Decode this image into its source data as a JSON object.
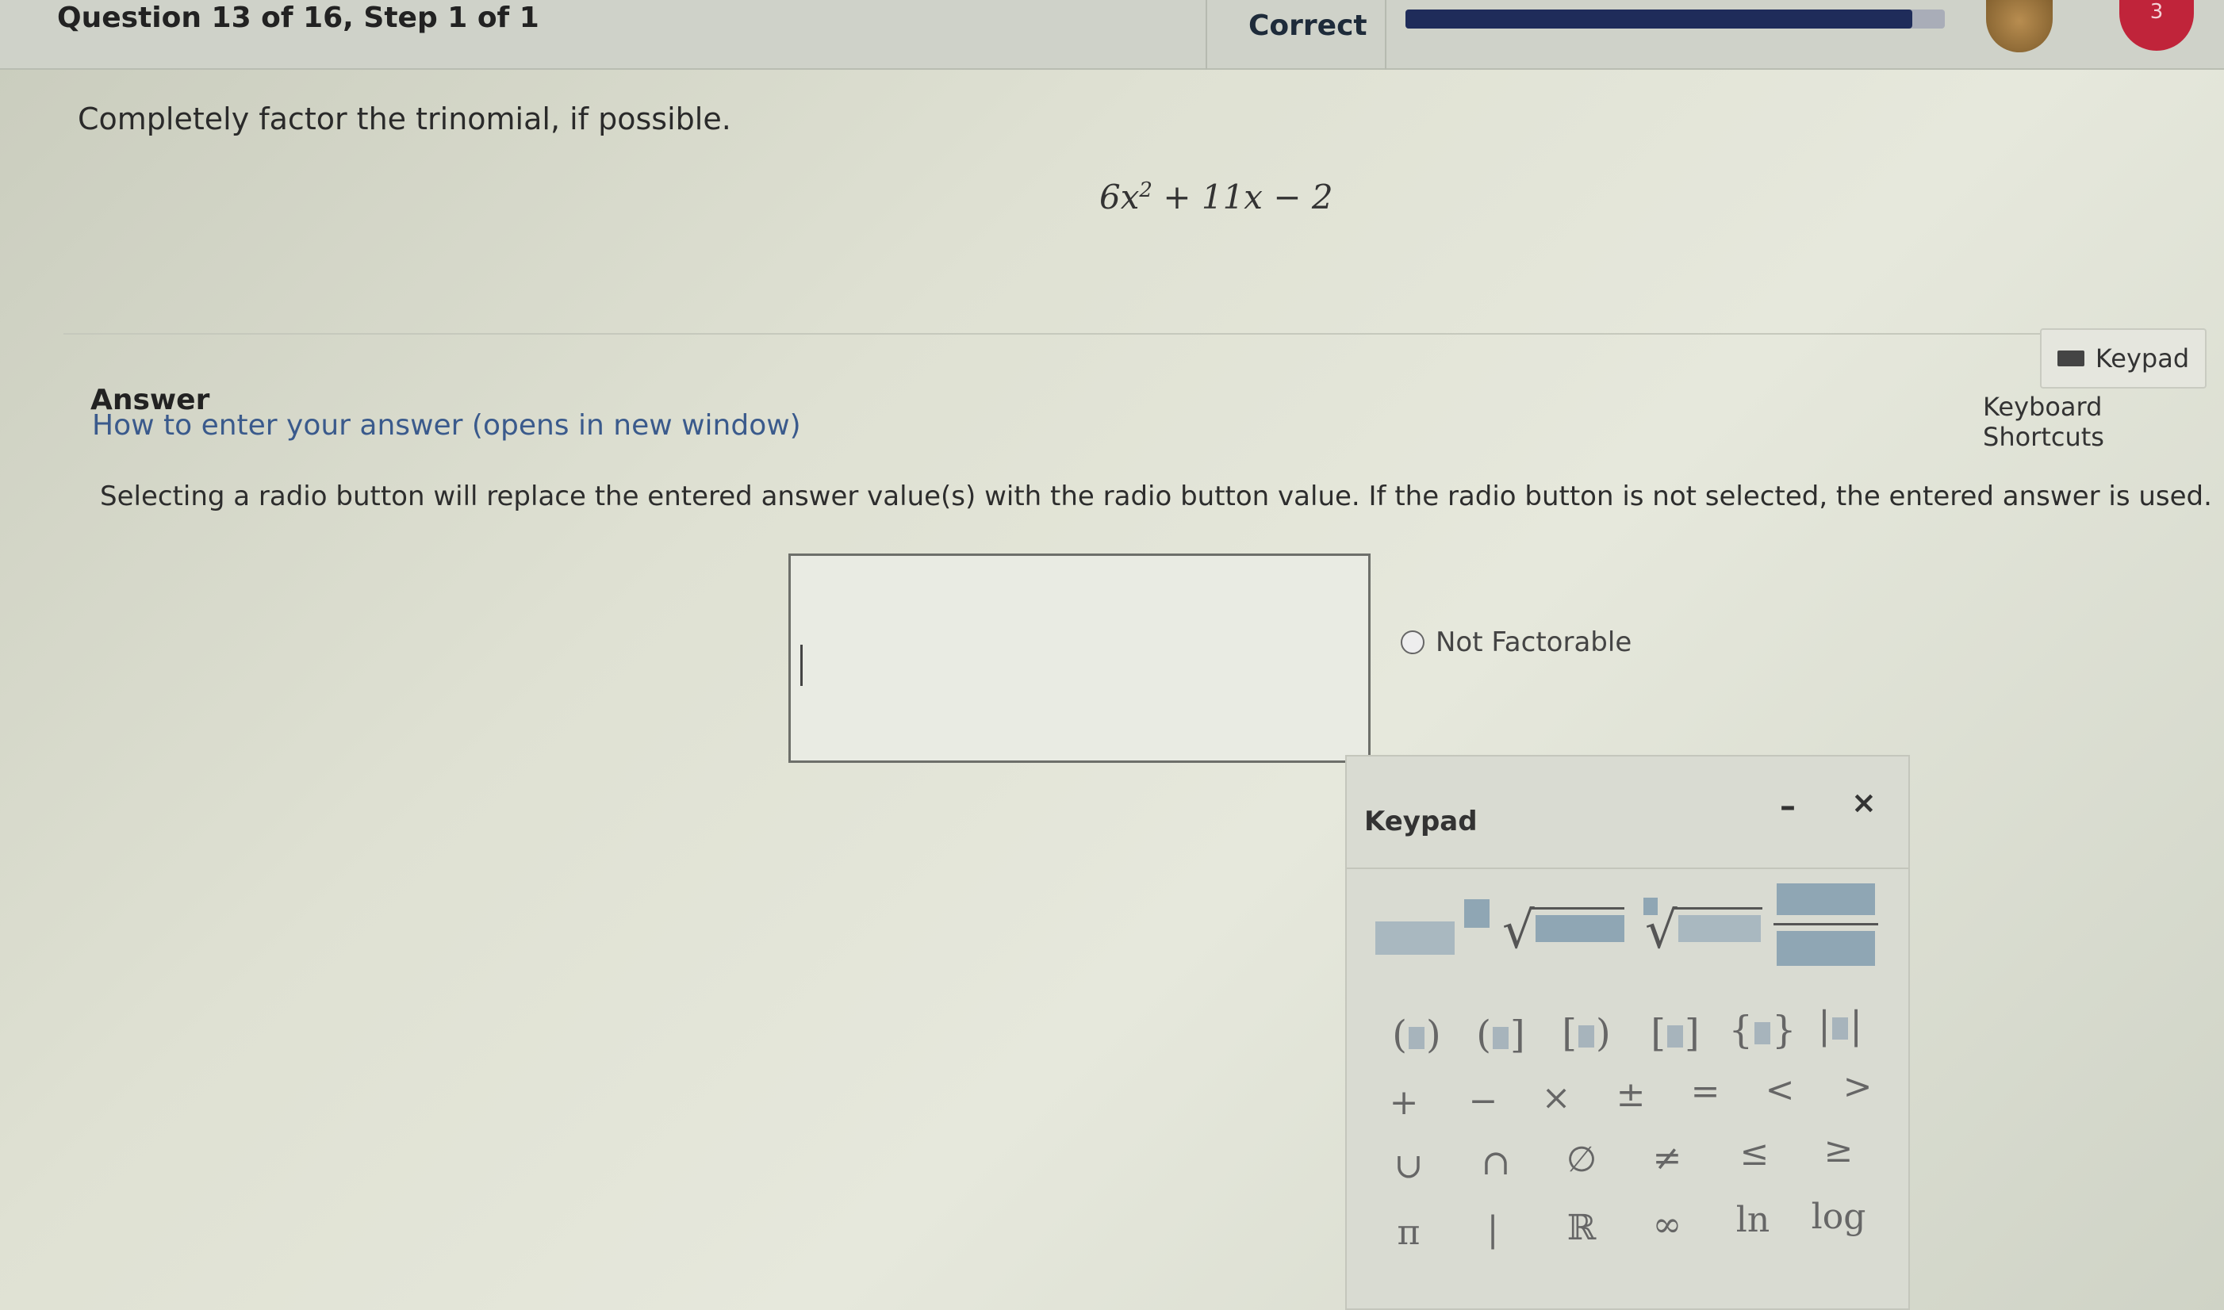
{
  "header": {
    "question_progress": "Question 13 of 16, Step 1 of 1",
    "status": "Correct",
    "progress_fraction": 0.94,
    "hearts": "3"
  },
  "question": {
    "prompt": "Completely factor the trinomial, if possible.",
    "expression": {
      "lead": "6x",
      "exponent": "2",
      "rest": " + 11x − 2"
    }
  },
  "answer": {
    "label": "Answer",
    "how_to_link": "How to enter your answer (opens in new window)",
    "instructions": "Selecting a radio button will replace the entered answer value(s) with the radio button value. If the radio button is not selected, the entered answer is used.",
    "input_value": "",
    "radio_option": "Not Factorable"
  },
  "tools": {
    "keypad_button": "Keypad",
    "shortcuts_link": "Keyboard Shortcuts"
  },
  "keypad": {
    "title": "Keypad",
    "minimize": "–",
    "close": "×",
    "row_brackets": [
      "(",
      ")",
      "(",
      "]",
      "[",
      ")",
      "[",
      "]",
      "{",
      "}",
      "|",
      "|"
    ],
    "row_ops": [
      "+",
      "−",
      "×",
      "±",
      "=",
      "<",
      ">"
    ],
    "row_sets": [
      "∪",
      "∩",
      "∅",
      "≠",
      "≤",
      "≥"
    ],
    "row_misc": [
      "π",
      "|",
      "ℝ",
      "∞",
      "ln",
      "log"
    ]
  },
  "colors": {
    "status_bar_fill": "#1f2c5a",
    "heart": "#c0243a",
    "link": "#3a5a8c",
    "template_block": "#8fa6b4"
  }
}
